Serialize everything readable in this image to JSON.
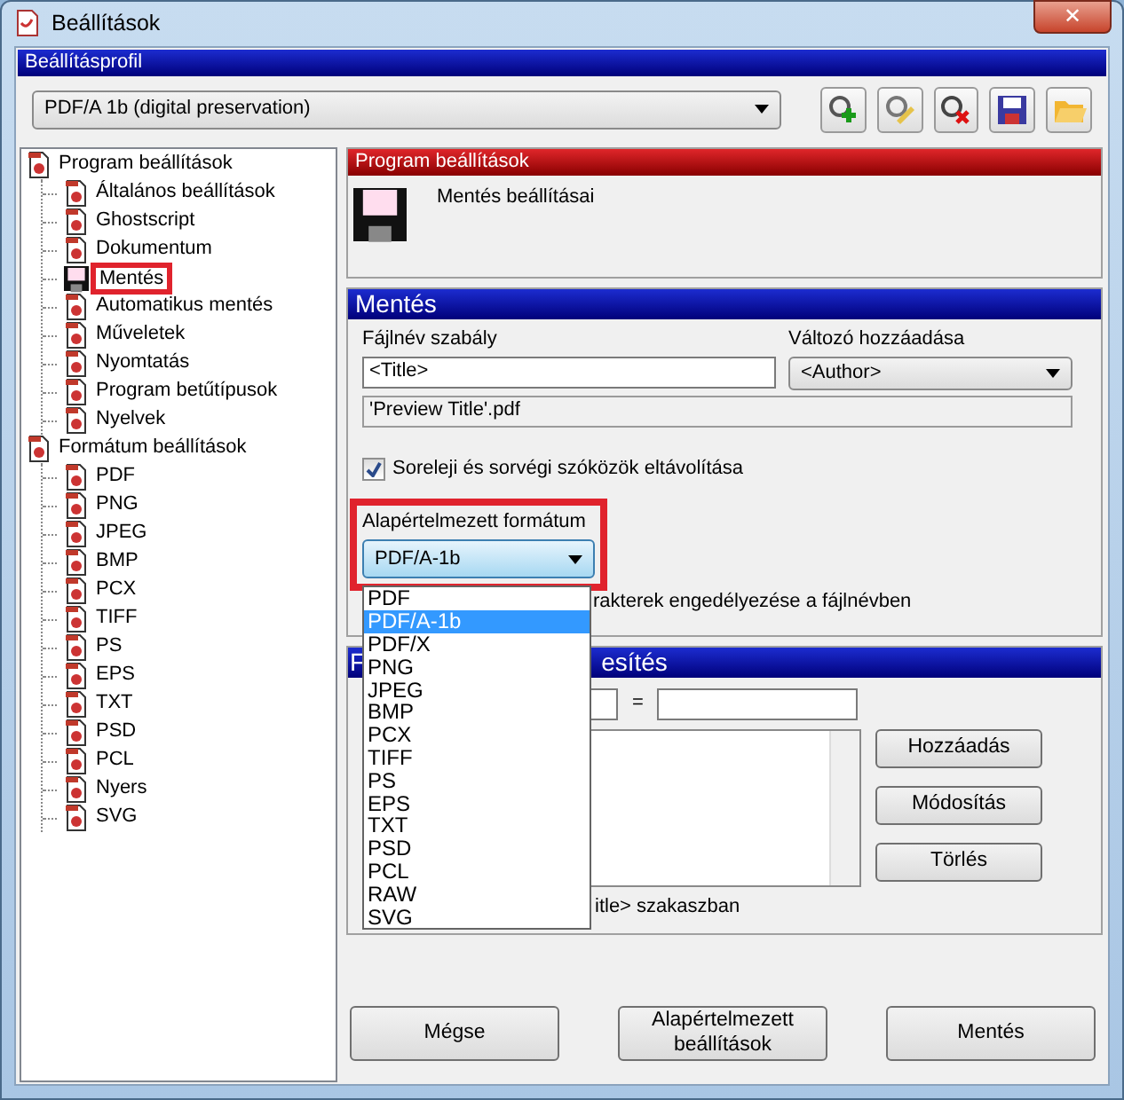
{
  "window": {
    "title": "Beállítások",
    "close": "✕"
  },
  "profile": {
    "header": "Beállításprofil",
    "value": "PDF/A 1b (digital preservation)"
  },
  "tree": [
    {
      "label": "Program beállítások",
      "kind": "page",
      "children": [
        {
          "label": "Általános beállítások",
          "kind": "page"
        },
        {
          "label": "Ghostscript",
          "kind": "page"
        },
        {
          "label": "Dokumentum",
          "kind": "page"
        },
        {
          "label": "Mentés",
          "kind": "floppy",
          "highlighted": true
        },
        {
          "label": "Automatikus mentés",
          "kind": "page"
        },
        {
          "label": "Műveletek",
          "kind": "page"
        },
        {
          "label": "Nyomtatás",
          "kind": "page"
        },
        {
          "label": "Program betűtípusok",
          "kind": "page"
        },
        {
          "label": "Nyelvek",
          "kind": "page"
        }
      ]
    },
    {
      "label": "Formátum beállítások",
      "kind": "page",
      "children": [
        {
          "label": "PDF",
          "kind": "page"
        },
        {
          "label": "PNG",
          "kind": "page"
        },
        {
          "label": "JPEG",
          "kind": "page"
        },
        {
          "label": "BMP",
          "kind": "page"
        },
        {
          "label": "PCX",
          "kind": "page"
        },
        {
          "label": "TIFF",
          "kind": "page"
        },
        {
          "label": "PS",
          "kind": "page"
        },
        {
          "label": "EPS",
          "kind": "page"
        },
        {
          "label": "TXT",
          "kind": "page"
        },
        {
          "label": "PSD",
          "kind": "page"
        },
        {
          "label": "PCL",
          "kind": "page"
        },
        {
          "label": "Nyers",
          "kind": "page"
        },
        {
          "label": "SVG",
          "kind": "page"
        }
      ]
    }
  ],
  "program_section": {
    "header": "Program beállítások",
    "caption": "Mentés beállításai"
  },
  "save_section": {
    "header": "Mentés",
    "filename_label": "Fájlnév szabály",
    "filename_value": "<Title>",
    "variable_label": "Változó hozzáadása",
    "variable_value": "<Author>",
    "preview": "'Preview Title'.pdf",
    "trim_checkbox": {
      "label": "Soreleji és sorvégi szóközök eltávolítása",
      "checked": true
    },
    "format_label": "Alapértelmezett formátum",
    "format_value": "PDF/A-1b",
    "format_highlighted": true,
    "chars_checkbox_visible_text": "rakterek engedélyezése a fájlnévben"
  },
  "format_dropdown": [
    {
      "label": "PDF",
      "selected": false
    },
    {
      "label": "PDF/A-1b",
      "selected": true
    },
    {
      "label": "PDF/X",
      "selected": false
    },
    {
      "label": "PNG",
      "selected": false
    },
    {
      "label": "JPEG",
      "selected": false
    },
    {
      "label": "BMP",
      "selected": false
    },
    {
      "label": "PCX",
      "selected": false
    },
    {
      "label": "TIFF",
      "selected": false
    },
    {
      "label": "PS",
      "selected": false
    },
    {
      "label": "EPS",
      "selected": false
    },
    {
      "label": "TXT",
      "selected": false
    },
    {
      "label": "PSD",
      "selected": false
    },
    {
      "label": "PCL",
      "selected": false
    },
    {
      "label": "RAW",
      "selected": false
    },
    {
      "label": "SVG",
      "selected": false
    }
  ],
  "replace_section": {
    "header_start": "F",
    "header_end": "esítés",
    "equals": "=",
    "buttons": [
      "Hozzáadás",
      "Módosítás",
      "Törlés"
    ],
    "checkbox_visible_text": "itle> szakaszban"
  },
  "footer_buttons": [
    "Mégse",
    "Alapértelmezett beállítások",
    "Mentés"
  ]
}
